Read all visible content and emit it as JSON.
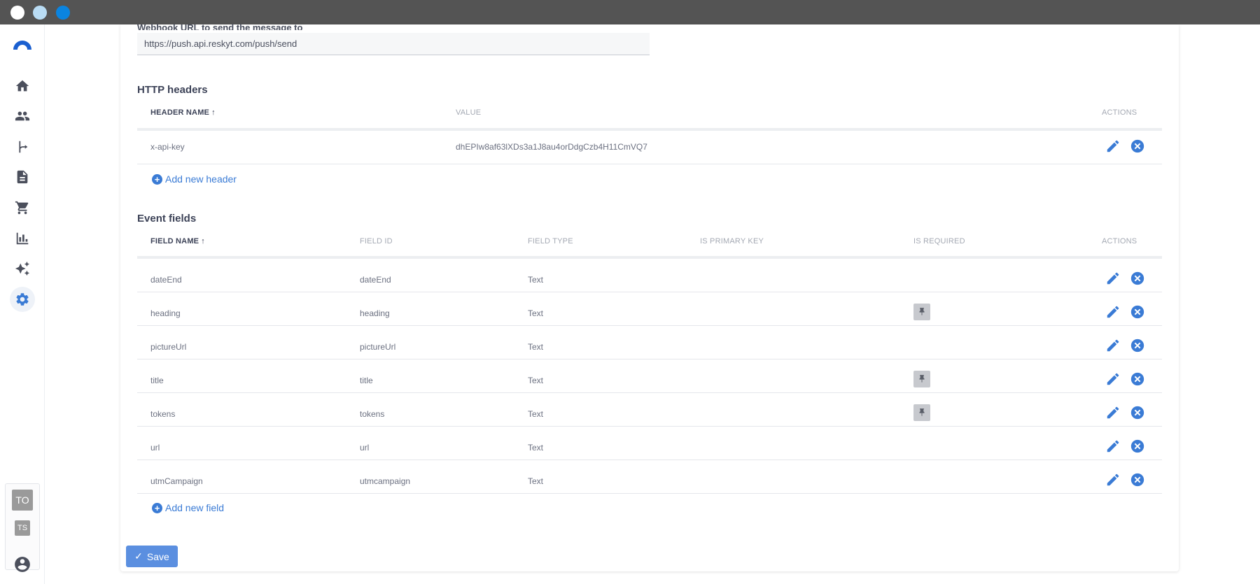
{
  "window": {
    "traffic_lights": [
      "close",
      "minimize",
      "zoom"
    ]
  },
  "sidebar": {
    "items": [
      {
        "name": "home",
        "icon": "home-icon"
      },
      {
        "name": "people",
        "icon": "people-icon"
      },
      {
        "name": "flows",
        "icon": "branch-icon"
      },
      {
        "name": "documents",
        "icon": "document-icon"
      },
      {
        "name": "cart",
        "icon": "cart-icon"
      },
      {
        "name": "analytics",
        "icon": "bar-chart-icon"
      },
      {
        "name": "ai",
        "icon": "sparkle-icon"
      },
      {
        "name": "settings",
        "icon": "gear-icon",
        "active": true
      }
    ],
    "workspace_primary": "TO",
    "workspace_secondary": "TS"
  },
  "webhook": {
    "label": "Webhook URL to send the message to",
    "value": "https://push.api.reskyt.com/push/send"
  },
  "http_headers": {
    "title": "HTTP headers",
    "columns": {
      "name": "HEADER NAME",
      "value": "VALUE",
      "actions": "ACTIONS"
    },
    "rows": [
      {
        "name": "x-api-key",
        "value": "dhEPIw8af63lXDs3a1J8au4orDdgCzb4H11CmVQ7"
      }
    ],
    "add_label": "Add new header"
  },
  "event_fields": {
    "title": "Event fields",
    "columns": {
      "name": "FIELD NAME",
      "id": "FIELD ID",
      "type": "FIELD TYPE",
      "primary": "IS PRIMARY KEY",
      "required": "IS REQUIRED",
      "actions": "ACTIONS"
    },
    "rows": [
      {
        "name": "dateEnd",
        "id": "dateEnd",
        "type": "Text",
        "required": false
      },
      {
        "name": "heading",
        "id": "heading",
        "type": "Text",
        "required": true
      },
      {
        "name": "pictureUrl",
        "id": "pictureUrl",
        "type": "Text",
        "required": false
      },
      {
        "name": "title",
        "id": "title",
        "type": "Text",
        "required": true
      },
      {
        "name": "tokens",
        "id": "tokens",
        "type": "Text",
        "required": true
      },
      {
        "name": "url",
        "id": "url",
        "type": "Text",
        "required": false
      },
      {
        "name": "utmCampaign",
        "id": "utmcampaign",
        "type": "Text",
        "required": false
      }
    ],
    "add_label": "Add new field"
  },
  "save_label": "Save",
  "colors": {
    "accent": "#3a7bd5",
    "save": "#5b8fe0",
    "titlebar": "#545454"
  }
}
